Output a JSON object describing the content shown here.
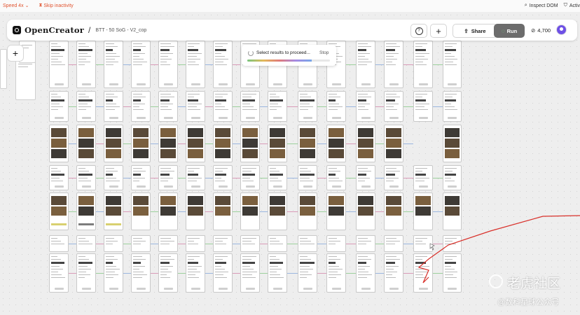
{
  "replay_bar": {
    "speed_label": "Speed 4x",
    "skip_label": "Skip inactivity",
    "inspect_label": "Inspect DOM",
    "activity_label": "Activ"
  },
  "header": {
    "brand": "OpenCreator",
    "separator": "/",
    "project": "BTT - 50 SoG - V2_cop",
    "share_label": "Share",
    "run_label": "Run",
    "credits": "4,700",
    "add_label": "+",
    "help_label": "?"
  },
  "progress": {
    "message": "Select results to proceed...",
    "stop_label": "Stop",
    "fill_fraction": 0.78
  },
  "canvas": {
    "add_label": "+"
  },
  "watermark": {
    "line1": "老虎社区",
    "line2": "@数科星球公众号"
  },
  "colors": {
    "accent": "#e0532f",
    "run_bg": "#6c6c6c",
    "avatar": "#6e50e6",
    "annotation_red": "#d9302a"
  }
}
